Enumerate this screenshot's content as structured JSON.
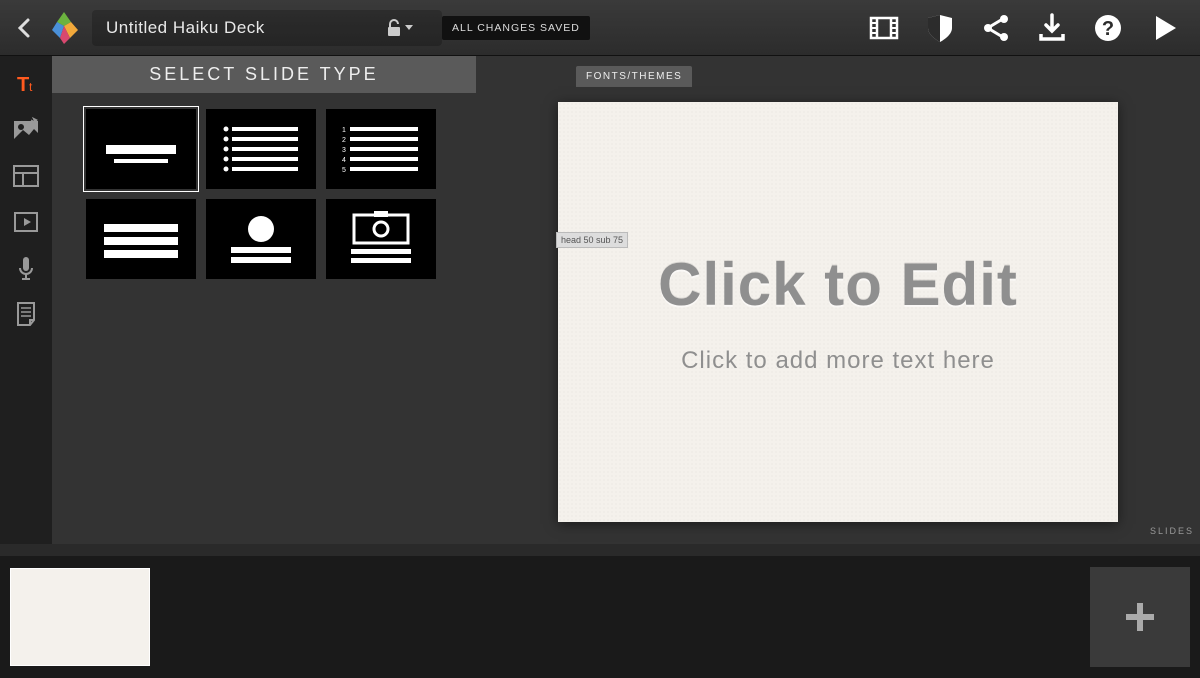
{
  "header": {
    "deck_title": "Untitled Haiku Deck",
    "save_status": "ALL CHANGES SAVED"
  },
  "panel": {
    "title": "SELECT SLIDE TYPE"
  },
  "canvas": {
    "fonts_tab": "FONTS/THEMES",
    "dim_tag": "head 50 sub 75",
    "headline": "Click to Edit",
    "subline": "Click to add more text here"
  },
  "tray": {
    "slides_label": "SLIDES"
  }
}
